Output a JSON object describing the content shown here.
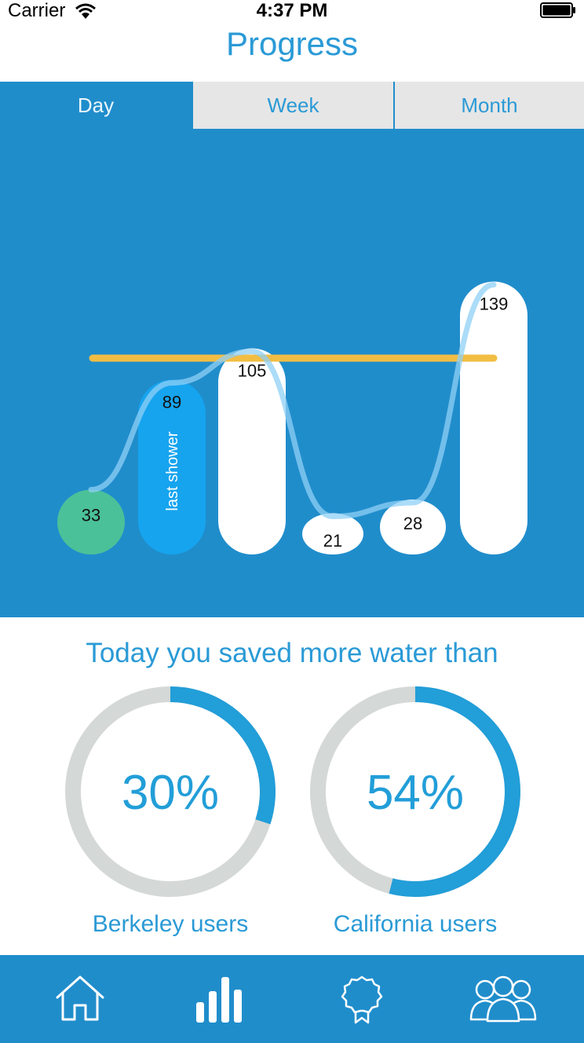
{
  "status_bar": {
    "carrier": "Carrier",
    "time": "4:37 PM"
  },
  "header": {
    "title": "Progress"
  },
  "tabs": [
    {
      "label": "Day",
      "selected": true
    },
    {
      "label": "Week",
      "selected": false
    },
    {
      "label": "Month",
      "selected": false
    }
  ],
  "chart_data": {
    "type": "bar",
    "values": [
      33,
      89,
      105,
      21,
      28,
      139
    ],
    "bar_labels": [
      "33",
      "89",
      "105",
      "21",
      "28",
      "139"
    ],
    "highlight_label": "last shower",
    "highlight_index": 1,
    "first_color": "#4bc199",
    "highlight_color": "#16a4ef",
    "bar_color": "#ffffff",
    "reference_line": 100,
    "reference_color": "#f2bd43",
    "trend_color": "#8fd0f5"
  },
  "summary": {
    "title": "Today you saved more water than",
    "comparisons": [
      {
        "value": 30,
        "label_value": "30%",
        "label": "Berkeley users"
      },
      {
        "value": 54,
        "label_value": "54%",
        "label": "California users"
      }
    ],
    "ring_color": "#229ed8",
    "track_color": "#d4d8d6"
  },
  "tab_bar": {
    "items": [
      "home-icon",
      "progress-icon",
      "award-icon",
      "community-icon"
    ],
    "selected": 1
  }
}
